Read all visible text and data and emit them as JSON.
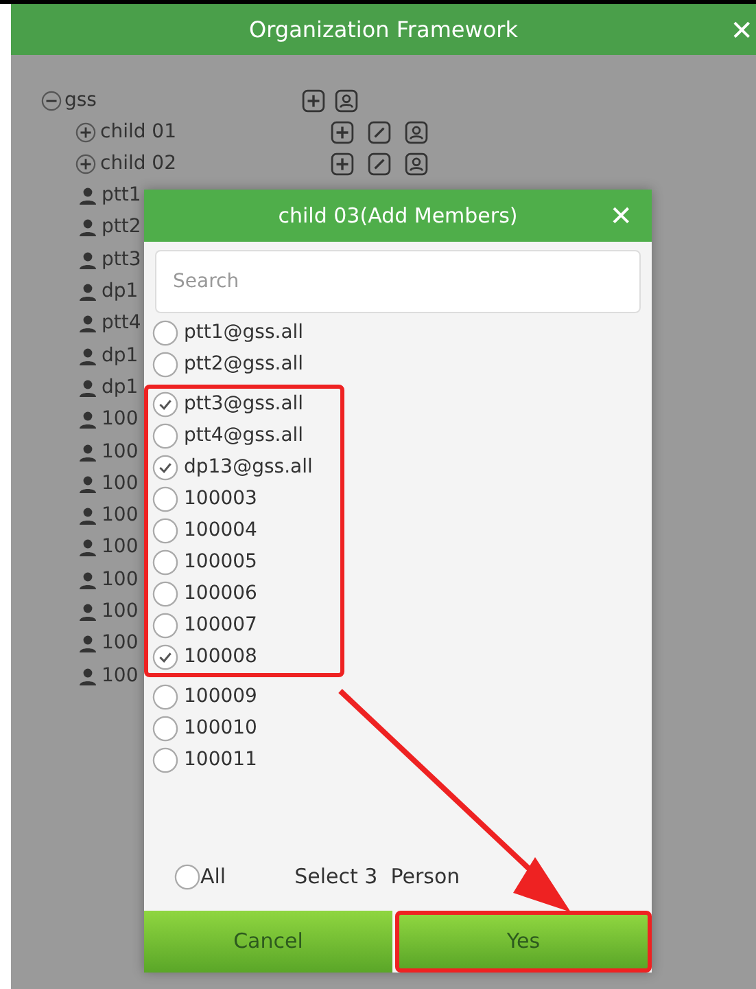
{
  "window": {
    "title": "Organization Framework",
    "close": "✕"
  },
  "tree": {
    "label": "gss",
    "expanded": true,
    "actions": [
      {
        "kind": "add"
      },
      {
        "kind": "member"
      }
    ],
    "children": [
      {
        "label": "child 01",
        "expanded": false,
        "actions": [
          {
            "kind": "add"
          },
          {
            "kind": "edit"
          },
          {
            "kind": "member"
          }
        ]
      },
      {
        "label": "child 02",
        "expanded": false,
        "actions": [
          {
            "kind": "add"
          },
          {
            "kind": "edit"
          },
          {
            "kind": "member"
          }
        ]
      }
    ],
    "members": [
      "ptt1",
      "ptt2",
      "ptt3",
      "dp1",
      "ptt4",
      "dp1",
      "dp1",
      "100",
      "100",
      "100",
      "100",
      "100",
      "100",
      "100",
      "100",
      "100"
    ]
  },
  "dialog": {
    "title": "child 03(Add Members)",
    "close": "✕",
    "search": {
      "placeholder": "Search"
    },
    "member_groups": [
      {
        "highlighted": false,
        "members": [
          {
            "label": "ptt1@gss.all",
            "checked": false
          },
          {
            "label": "ptt2@gss.all",
            "checked": false
          }
        ]
      },
      {
        "highlighted": true,
        "members": [
          {
            "label": "ptt3@gss.all",
            "checked": true
          },
          {
            "label": "ptt4@gss.all",
            "checked": false
          },
          {
            "label": "dp13@gss.all",
            "checked": true
          },
          {
            "label": "100003",
            "checked": false
          },
          {
            "label": "100004",
            "checked": false
          },
          {
            "label": "100005",
            "checked": false
          },
          {
            "label": "100006",
            "checked": false
          },
          {
            "label": "100007",
            "checked": false
          },
          {
            "label": "100008",
            "checked": true
          }
        ]
      },
      {
        "highlighted": false,
        "members": [
          {
            "label": "100009",
            "checked": false
          },
          {
            "label": "100010",
            "checked": false
          },
          {
            "label": "100011",
            "checked": false
          }
        ]
      }
    ],
    "select_all": {
      "label": "All",
      "checked": false
    },
    "summary": "Select 3  Person",
    "buttons": [
      {
        "label": "Cancel",
        "highlighted": false
      },
      {
        "label": "Yes",
        "highlighted": true
      }
    ]
  }
}
